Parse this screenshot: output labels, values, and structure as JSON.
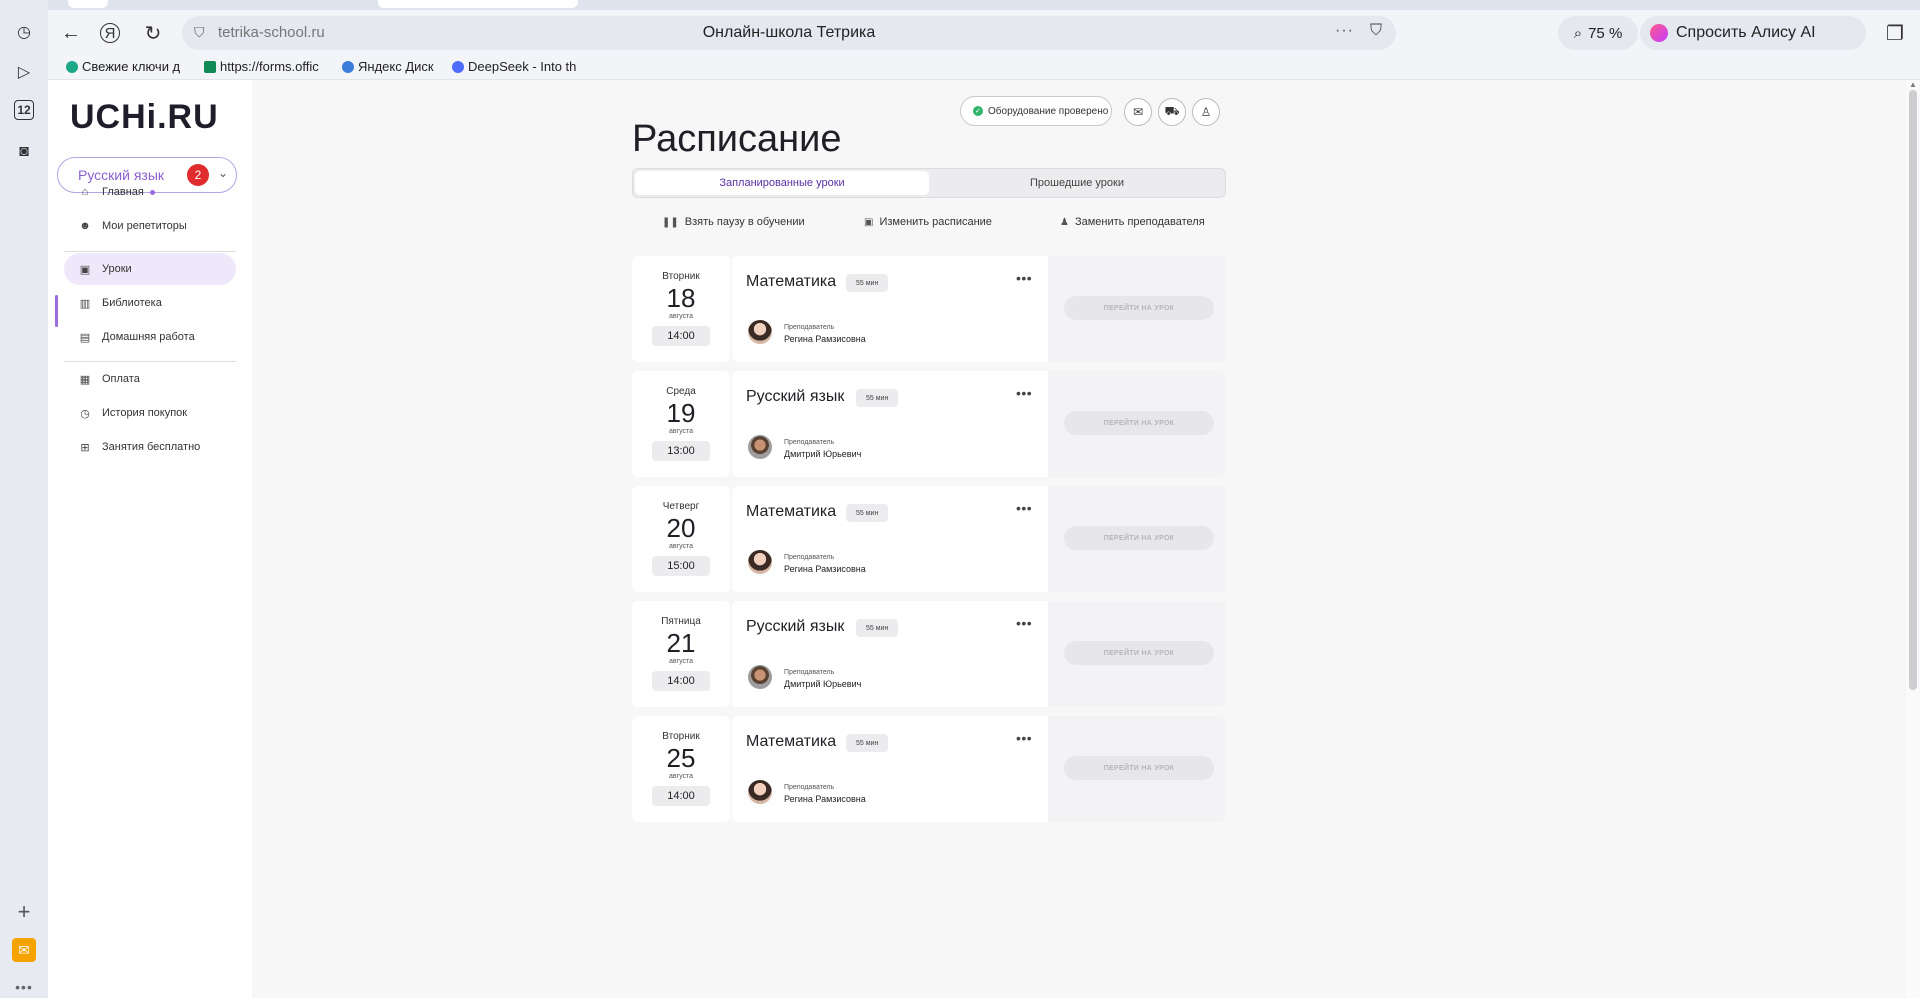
{
  "browser": {
    "url": "tetrika-school.ru",
    "page_title": "Онлайн-школа Тетрика",
    "zoom": "75 %",
    "alice_label": "Спросить Алису AI",
    "rail_counter": "12",
    "bookmarks": [
      {
        "label": "Свежие ключи д"
      },
      {
        "label": "https://forms.offic"
      },
      {
        "label": "Яндекс Диск"
      },
      {
        "label": "DeepSeek - Into th"
      }
    ]
  },
  "sidebar": {
    "logo": "UCHi.RU",
    "subject": "Русский язык",
    "subject_badge": "2",
    "nav_main": [
      {
        "label": "Главная",
        "icon": "home-icon"
      },
      {
        "label": "Мои репетиторы",
        "icon": "people-icon"
      }
    ],
    "nav_lessons": [
      {
        "label": "Уроки",
        "icon": "calendar-icon"
      },
      {
        "label": "Библиотека",
        "icon": "books-icon"
      },
      {
        "label": "Домашняя работа",
        "icon": "document-icon"
      }
    ],
    "nav_billing": [
      {
        "label": "Оплата",
        "icon": "wallet-icon"
      },
      {
        "label": "История покупок",
        "icon": "history-icon"
      },
      {
        "label": "Занятия бесплатно",
        "icon": "gift-icon"
      }
    ]
  },
  "header": {
    "equipment_status": "Оборудование проверено"
  },
  "schedule": {
    "title": "Расписание",
    "tabs": [
      {
        "label": "Запланированные уроки",
        "active": true
      },
      {
        "label": "Прошедшие уроки",
        "active": false
      }
    ],
    "actions": [
      {
        "label": "Взять паузу в обучении",
        "icon": "pause-icon"
      },
      {
        "label": "Изменить расписание",
        "icon": "calendar-edit-icon"
      },
      {
        "label": "Заменить преподавателя",
        "icon": "person-icon"
      }
    ],
    "teacher_label": "Преподаватель",
    "goto_label": "ПЕРЕЙТИ НА УРОК",
    "lessons": [
      {
        "weekday": "Вторник",
        "day": "18",
        "month": "августа",
        "time": "14:00",
        "subject": "Математика",
        "duration": "55 мин",
        "teacher": "Регина Рамзисовна",
        "avatar": "f"
      },
      {
        "weekday": "Среда",
        "day": "19",
        "month": "августа",
        "time": "13:00",
        "subject": "Русский язык",
        "duration": "55 мин",
        "teacher": "Дмитрий Юрьевич",
        "avatar": "m"
      },
      {
        "weekday": "Четверг",
        "day": "20",
        "month": "августа",
        "time": "15:00",
        "subject": "Математика",
        "duration": "55 мин",
        "teacher": "Регина Рамзисовна",
        "avatar": "f"
      },
      {
        "weekday": "Пятница",
        "day": "21",
        "month": "августа",
        "time": "14:00",
        "subject": "Русский язык",
        "duration": "55 мин",
        "teacher": "Дмитрий Юрьевич",
        "avatar": "m"
      },
      {
        "weekday": "Вторник",
        "day": "25",
        "month": "августа",
        "time": "14:00",
        "subject": "Математика",
        "duration": "55 мин",
        "teacher": "Регина Рамзисовна",
        "avatar": "f"
      }
    ]
  }
}
